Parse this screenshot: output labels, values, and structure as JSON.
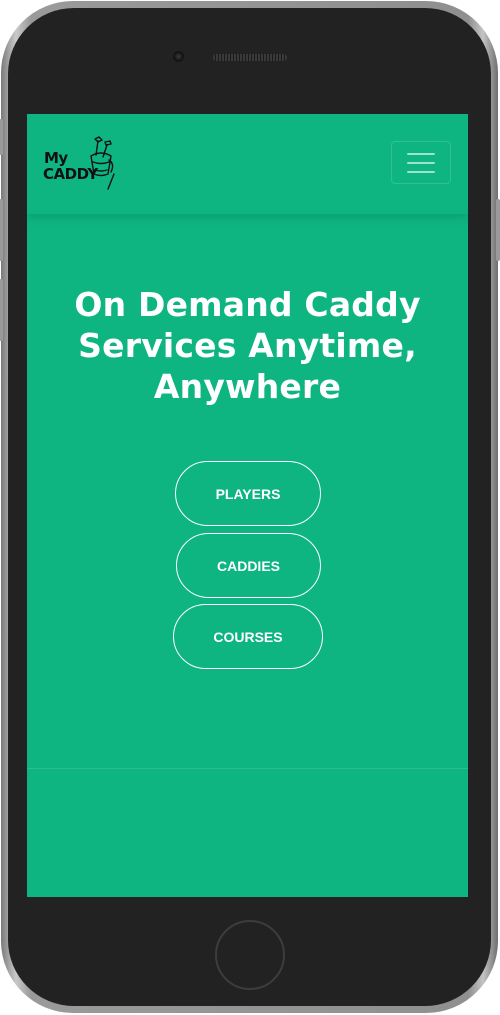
{
  "brand": {
    "logo_line1": "My",
    "logo_line2": "CADDY",
    "primary_color": "#0eb581"
  },
  "navbar": {
    "menu_icon": "hamburger-menu-icon"
  },
  "hero": {
    "title": "On Demand Caddy Services Anytime, Anywhere",
    "buttons": [
      {
        "label": "PLAYERS"
      },
      {
        "label": "CADDIES"
      },
      {
        "label": "COURSES"
      }
    ]
  }
}
